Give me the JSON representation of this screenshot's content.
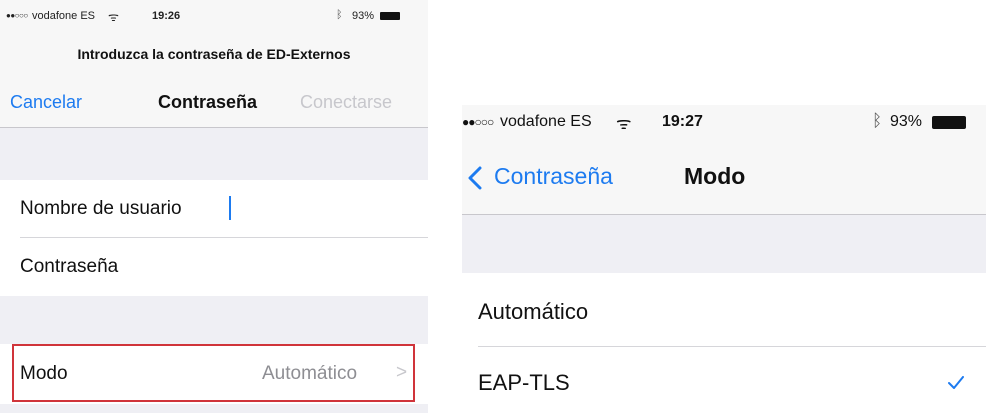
{
  "left": {
    "status": {
      "carrier": "vodafone ES",
      "time": "19:26",
      "battery": "93%"
    },
    "prompt": "Introduzca la contraseña de ED-Externos",
    "nav": {
      "cancel": "Cancelar",
      "title": "Contraseña",
      "connect": "Conectarse"
    },
    "fields": {
      "username": "Nombre de usuario",
      "password": "Contraseña"
    },
    "mode": {
      "label": "Modo",
      "value": "Automático"
    }
  },
  "right": {
    "status": {
      "carrier": "vodafone ES",
      "time": "19:27",
      "battery": "93%"
    },
    "nav": {
      "back": "Contraseña",
      "title": "Modo"
    },
    "options": [
      {
        "label": "Automático",
        "selected": false
      },
      {
        "label": "EAP-TLS",
        "selected": true
      }
    ]
  },
  "colors": {
    "accent": "#1d7bf0",
    "highlight_border": "#d0343a",
    "disabled": "#c7c7cc",
    "group_bg": "#efeff4"
  }
}
